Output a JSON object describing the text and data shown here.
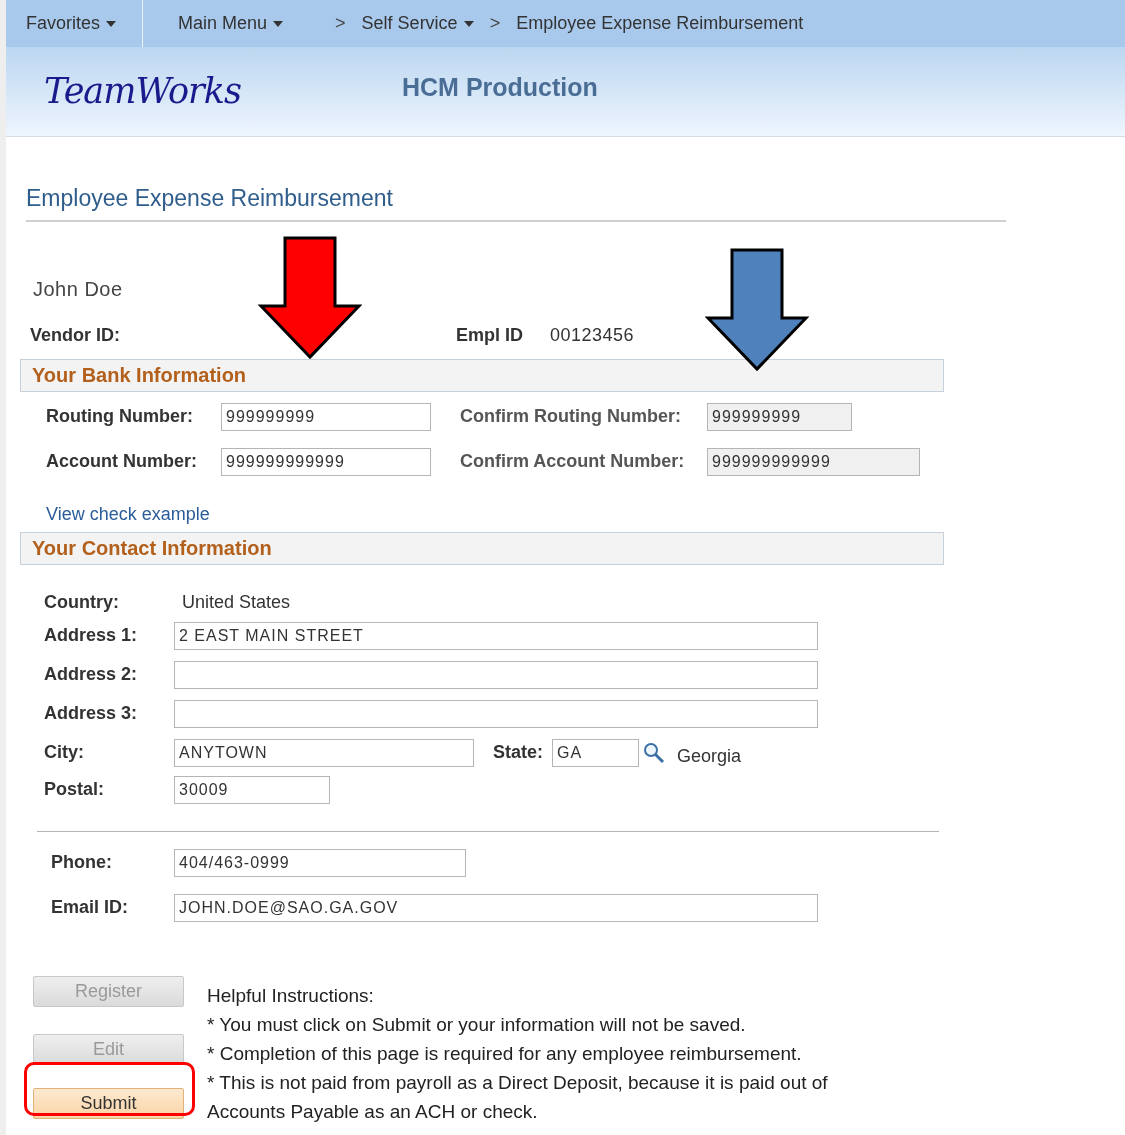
{
  "nav": {
    "items": [
      {
        "kind": "menu",
        "label": "Favorites",
        "caret": true
      },
      {
        "kind": "divider"
      },
      {
        "kind": "menu",
        "label": "Main Menu",
        "caret": true
      },
      {
        "kind": "separator",
        "label": ">"
      },
      {
        "kind": "menu",
        "label": "Self Service",
        "caret": true
      },
      {
        "kind": "separator",
        "label": ">"
      },
      {
        "kind": "menu",
        "label": "Employee Expense Reimbursement",
        "caret": false
      }
    ]
  },
  "header": {
    "logo": "TeamWorks",
    "environment": "HCM Production"
  },
  "page_title": "Employee Expense Reimbursement",
  "employee": {
    "name": "John Doe",
    "vendor_label": "Vendor ID:",
    "empl_label": "Empl ID",
    "empl_id": "00123456"
  },
  "bank": {
    "title": "Your Bank Information",
    "fields": [
      {
        "label": "Routing Number:",
        "value": "999999999",
        "readonly": false
      },
      {
        "label": "Confirm Routing Number:",
        "value": "999999999",
        "readonly": true
      },
      {
        "label": "Account Number:",
        "value": "999999999999",
        "readonly": false
      },
      {
        "label": "Confirm Account Number:",
        "value": "999999999999",
        "readonly": true
      }
    ],
    "link": "View check example"
  },
  "contact": {
    "title": "Your Contact Information",
    "country_label": "Country:",
    "country": "United States",
    "address": [
      {
        "label": "Address 1:",
        "value": "2 EAST MAIN STREET"
      },
      {
        "label": "Address 2:"
      },
      {
        "label": "Address 3:"
      }
    ],
    "city_label": "City:",
    "city": "ANYTOWN",
    "state_label": "State:",
    "state": "GA",
    "state_name": "Georgia",
    "postal_label": "Postal:",
    "postal": "30009",
    "phone_label": "Phone:",
    "phone": "404/463-0999",
    "email_label": "Email ID:",
    "email": "JOHN.DOE@SAO.GA.GOV"
  },
  "buttons": [
    {
      "label": "Register",
      "disabled": true,
      "highlighted": false
    },
    {
      "label": "Edit",
      "disabled": true,
      "highlighted": false
    },
    {
      "label": "Submit",
      "disabled": false,
      "highlighted": true
    }
  ],
  "instructions": [
    "Helpful Instructions:",
    "* You must click on Submit or your information will not be saved.",
    "* Completion of this page is required for any employee reimbursement.",
    "* This is not paid from payroll as a Direct Deposit, because it is paid out of Accounts Payable as an ACH or check."
  ],
  "annotations": [
    {
      "kind": "arrow",
      "color": "#ff0000"
    },
    {
      "kind": "arrow",
      "color": "#4f81bd"
    }
  ]
}
